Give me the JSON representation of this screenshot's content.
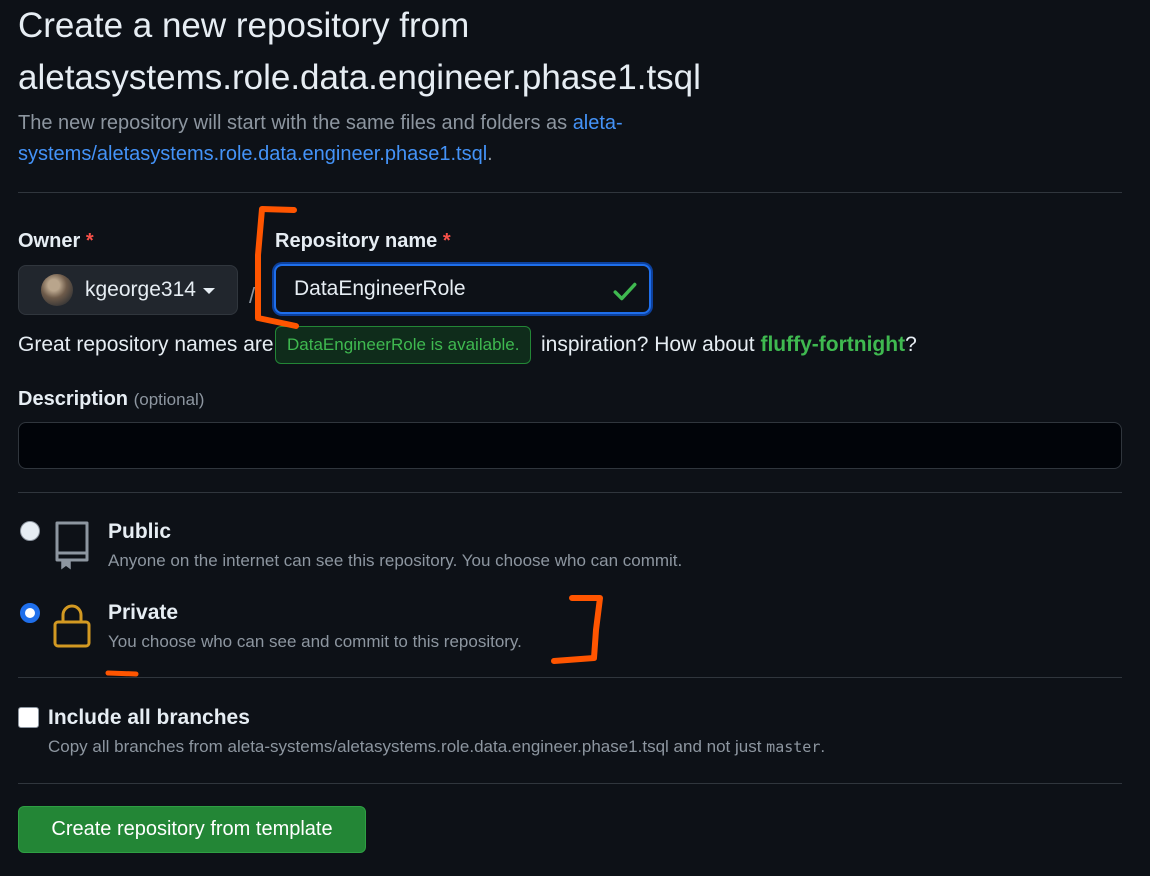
{
  "header": {
    "title_line1": "Create a new repository from",
    "title_line2": "aletasystems.role.data.engineer.phase1.tsql",
    "subtitle_prefix": "The new repository will start with the same files and folders as ",
    "template_link": "aleta-systems/aletasystems.role.data.engineer.phase1.tsql",
    "subtitle_suffix": "."
  },
  "owner": {
    "label": "Owner",
    "required_mark": "*",
    "selected": "kgeorge314"
  },
  "separator": "/",
  "repository_name": {
    "label": "Repository name",
    "required_mark": "*",
    "value": "DataEngineerRole",
    "availability_tooltip": "DataEngineerRole is available."
  },
  "name_hint": {
    "prefix": "Great repository names are",
    "middle": "inspiration? How about ",
    "suggestion": "fluffy-fortnight",
    "suffix": "?"
  },
  "description": {
    "label": "Description",
    "optional": "(optional)",
    "value": ""
  },
  "visibility": {
    "public": {
      "title": "Public",
      "description": "Anyone on the internet can see this repository. You choose who can commit.",
      "selected": false
    },
    "private": {
      "title": "Private",
      "description": "You choose who can see and commit to this repository.",
      "selected": true
    }
  },
  "branches": {
    "label": "Include all branches",
    "description_prefix": "Copy all branches from aleta-systems/aletasystems.role.data.engineer.phase1.tsql and not just ",
    "branch_name": "master",
    "description_suffix": ".",
    "checked": false
  },
  "submit": {
    "label": "Create repository from template"
  },
  "colors": {
    "background": "#0d1117",
    "link": "#4493f8",
    "success": "#3fb950",
    "primary_button": "#238636",
    "annotation": "#ff5500"
  }
}
